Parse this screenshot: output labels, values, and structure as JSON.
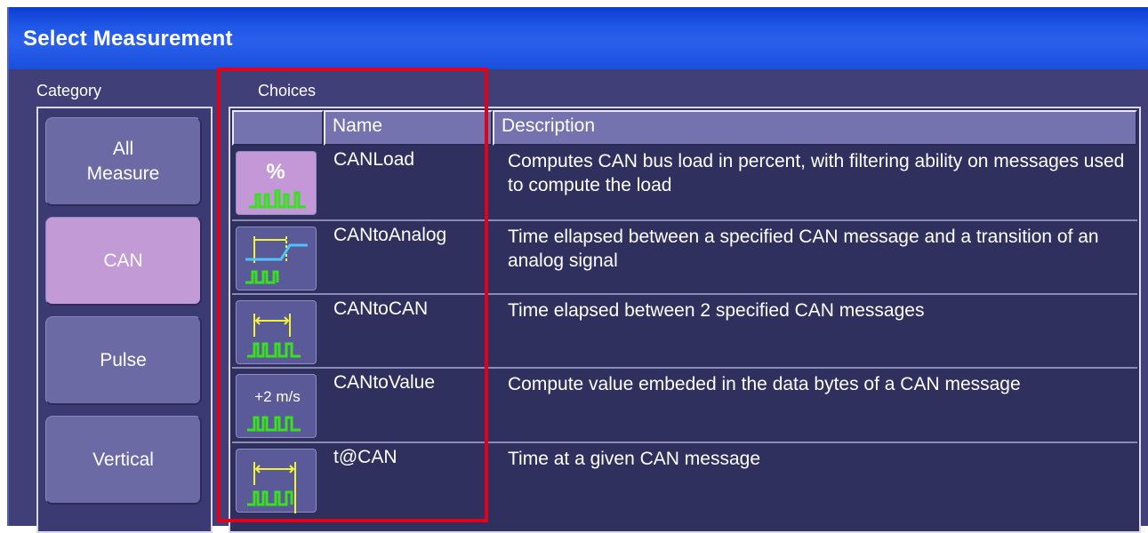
{
  "window": {
    "title": "Select Measurement"
  },
  "category": {
    "label": "Category",
    "items": [
      {
        "label_line1": "All",
        "label_line2": "Measure",
        "active": false
      },
      {
        "label_line1": "CAN",
        "label_line2": "",
        "active": true
      },
      {
        "label_line1": "Pulse",
        "label_line2": "",
        "active": false
      },
      {
        "label_line1": "Vertical",
        "label_line2": "",
        "active": false
      }
    ]
  },
  "choices": {
    "label": "Choices",
    "columns": {
      "icon": "",
      "name": "Name",
      "description": "Description"
    },
    "rows": [
      {
        "icon": "percent-icon",
        "icon_text": "%",
        "name": "CANLoad",
        "description": "Computes CAN bus load in percent, with filtering ability on messages used to compute the load",
        "selected": true
      },
      {
        "icon": "can-to-analog-icon",
        "icon_text": "",
        "name": "CANtoAnalog",
        "description": "Time ellapsed between a specified CAN message and a transition of an analog signal",
        "selected": false
      },
      {
        "icon": "can-to-can-icon",
        "icon_text": "",
        "name": "CANtoCAN",
        "description": "Time elapsed between 2 specified CAN messages",
        "selected": false
      },
      {
        "icon": "can-to-value-icon",
        "icon_text": "+2 m/s",
        "name": "CANtoValue",
        "description": "Compute value embeded in the data bytes of a CAN message",
        "selected": false
      },
      {
        "icon": "time-at-can-icon",
        "icon_text": "",
        "name": "t@CAN",
        "description": "Time at a given CAN message",
        "selected": false
      }
    ]
  },
  "colors": {
    "title_bar": "#1f56e6",
    "window_bg": "#403f77",
    "active_category": "#c29ad6",
    "icon_waveform": "#39e01f",
    "icon_marker": "#f2f23a",
    "highlight_box": "#e3001b"
  }
}
